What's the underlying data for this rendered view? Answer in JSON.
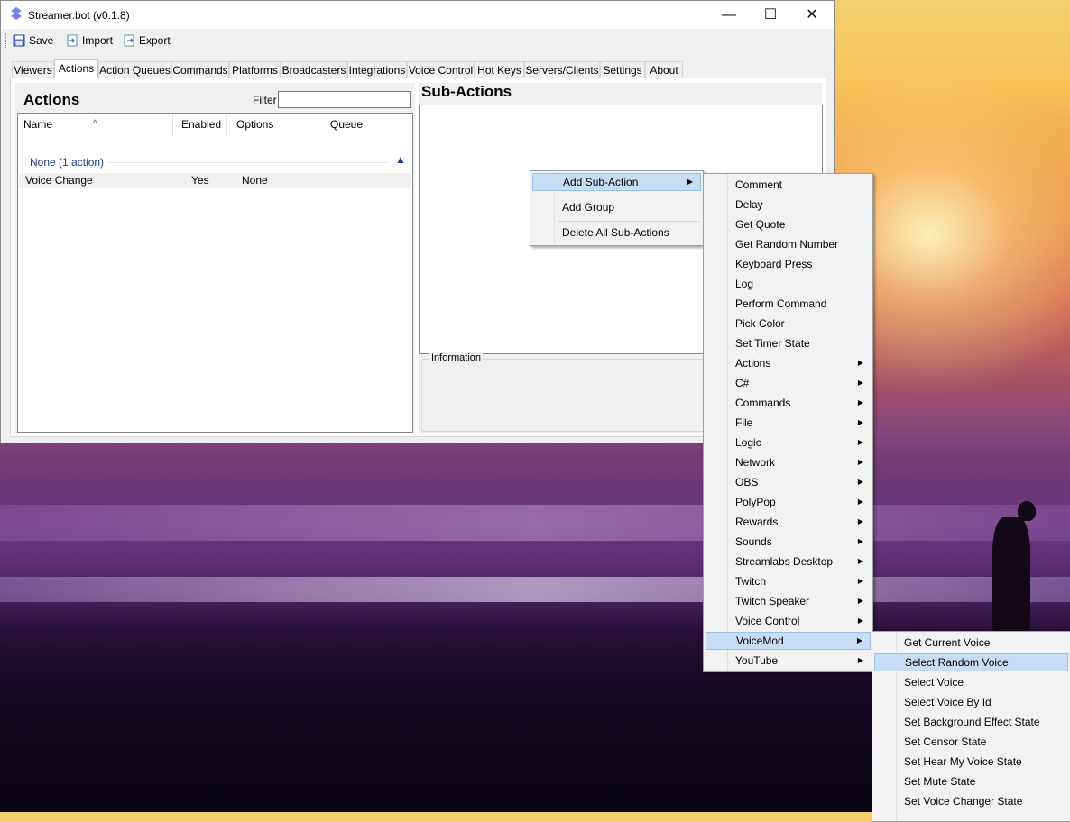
{
  "window": {
    "title": "Streamer.bot (v0.1.8)"
  },
  "toolbar": {
    "save": "Save",
    "import": "Import",
    "export": "Export"
  },
  "tabs": [
    "Viewers",
    "Actions",
    "Action Queues",
    "Commands",
    "Platforms",
    "Broadcasters",
    "Integrations",
    "Voice Control",
    "Hot Keys",
    "Servers/Clients",
    "Settings",
    "About"
  ],
  "actions_panel": {
    "heading": "Actions",
    "filter_label": "Filter",
    "filter_value": "",
    "columns": [
      "Name",
      "Enabled",
      "Options",
      "Queue"
    ],
    "group_label": "None (1 action)",
    "rows": [
      {
        "name": "Voice Change",
        "enabled": "Yes",
        "options": "None",
        "queue": ""
      }
    ]
  },
  "subactions_panel": {
    "heading": "Sub-Actions",
    "info_label": "Information"
  },
  "context_menu": [
    "Add Sub-Action",
    "Add Group",
    "Delete All Sub-Actions"
  ],
  "submenu": [
    "Comment",
    "Delay",
    "Get Quote",
    "Get Random Number",
    "Keyboard Press",
    "Log",
    "Perform Command",
    "Pick Color",
    "Set Timer State",
    "Actions",
    "C#",
    "Commands",
    "File",
    "Logic",
    "Network",
    "OBS",
    "PolyPop",
    "Rewards",
    "Sounds",
    "Streamlabs Desktop",
    "Twitch",
    "Twitch Speaker",
    "Voice Control",
    "VoiceMod",
    "YouTube"
  ],
  "voicemod_menu": [
    "Get Current Voice",
    "Select Random Voice",
    "Select Voice",
    "Select Voice By Id",
    "Set Background Effect State",
    "Set Censor State",
    "Set Hear My Voice State",
    "Set Mute State",
    "Set Voice Changer State"
  ],
  "colors": {
    "highlight": "#c5ddf5",
    "group_text": "#1e3a8a"
  }
}
